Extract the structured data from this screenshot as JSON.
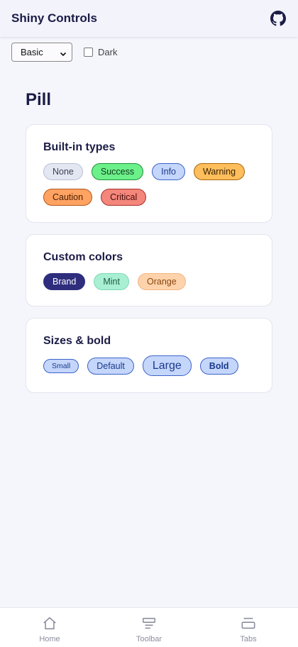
{
  "header": {
    "title": "Shiny Controls",
    "github_icon": "github-icon"
  },
  "controls": {
    "theme_select": {
      "value": "Basic"
    },
    "dark_checkbox": {
      "label": "Dark",
      "checked": false
    }
  },
  "page": {
    "title": "Pill"
  },
  "cards": [
    {
      "title": "Built-in types",
      "pills": [
        "None",
        "Success",
        "Info",
        "Warning",
        "Caution",
        "Critical"
      ]
    },
    {
      "title": "Custom colors",
      "pills": [
        "Brand",
        "Mint",
        "Orange"
      ]
    },
    {
      "title": "Sizes & bold",
      "pills": [
        "Small",
        "Default",
        "Large",
        "Bold"
      ]
    }
  ],
  "tabbar": {
    "items": [
      {
        "label": "Home",
        "icon": "home-icon"
      },
      {
        "label": "Toolbar",
        "icon": "toolbar-icon"
      },
      {
        "label": "Tabs",
        "icon": "tabs-icon"
      }
    ]
  },
  "colors": {
    "accent": "#2f2e7d",
    "text": "#1b1c46",
    "background": "#f5f6fc"
  }
}
